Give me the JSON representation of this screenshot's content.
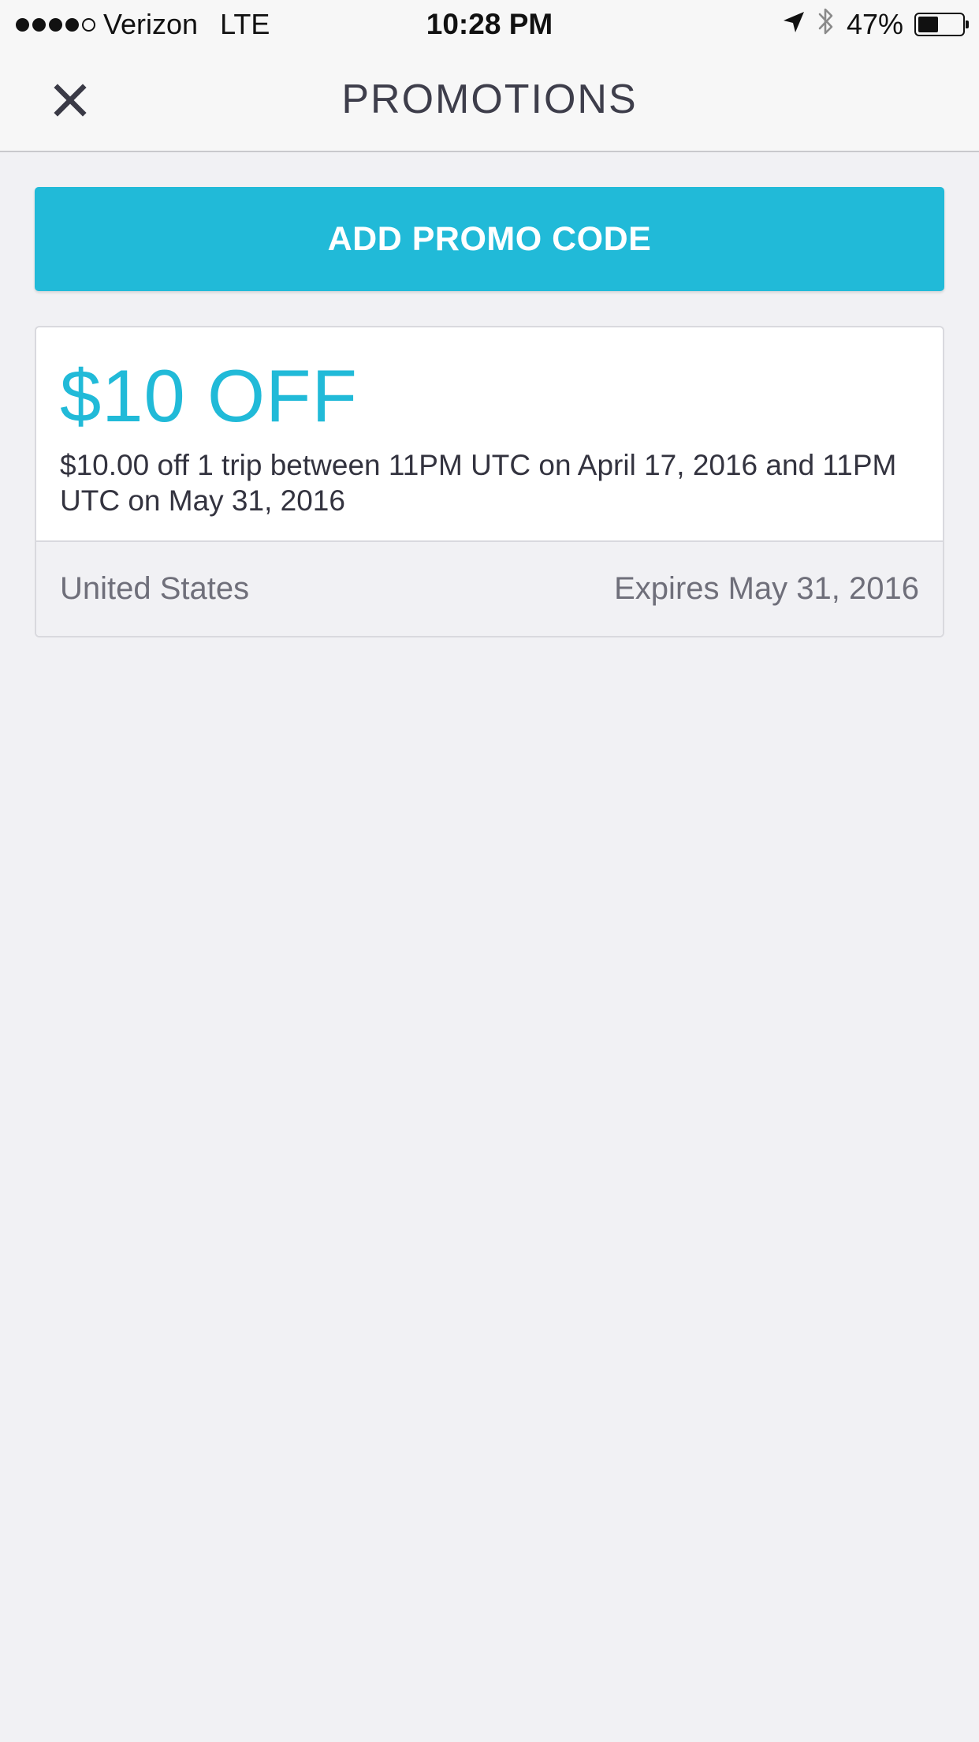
{
  "status_bar": {
    "signal_bars_filled": 4,
    "signal_bars_total": 5,
    "carrier": "Verizon",
    "network": "LTE",
    "time": "10:28 PM",
    "battery_percent": "47%",
    "battery_level": 0.47,
    "icons": [
      "location-arrow-icon",
      "bluetooth-icon",
      "battery-icon"
    ]
  },
  "nav": {
    "title": "PROMOTIONS",
    "close_icon": "close-icon"
  },
  "add_promo": {
    "label": "ADD PROMO CODE"
  },
  "promotions": [
    {
      "amount": "$10 OFF",
      "description": "$10.00 off 1 trip between 11PM UTC on April 17, 2016 and 11PM UTC on May 31, 2016",
      "region": "United States",
      "expires": "Expires May 31, 2016"
    }
  ],
  "colors": {
    "accent": "#21bad8",
    "background": "#f1f1f4",
    "text_dark": "#33333f",
    "text_muted": "#6f6f7a"
  }
}
